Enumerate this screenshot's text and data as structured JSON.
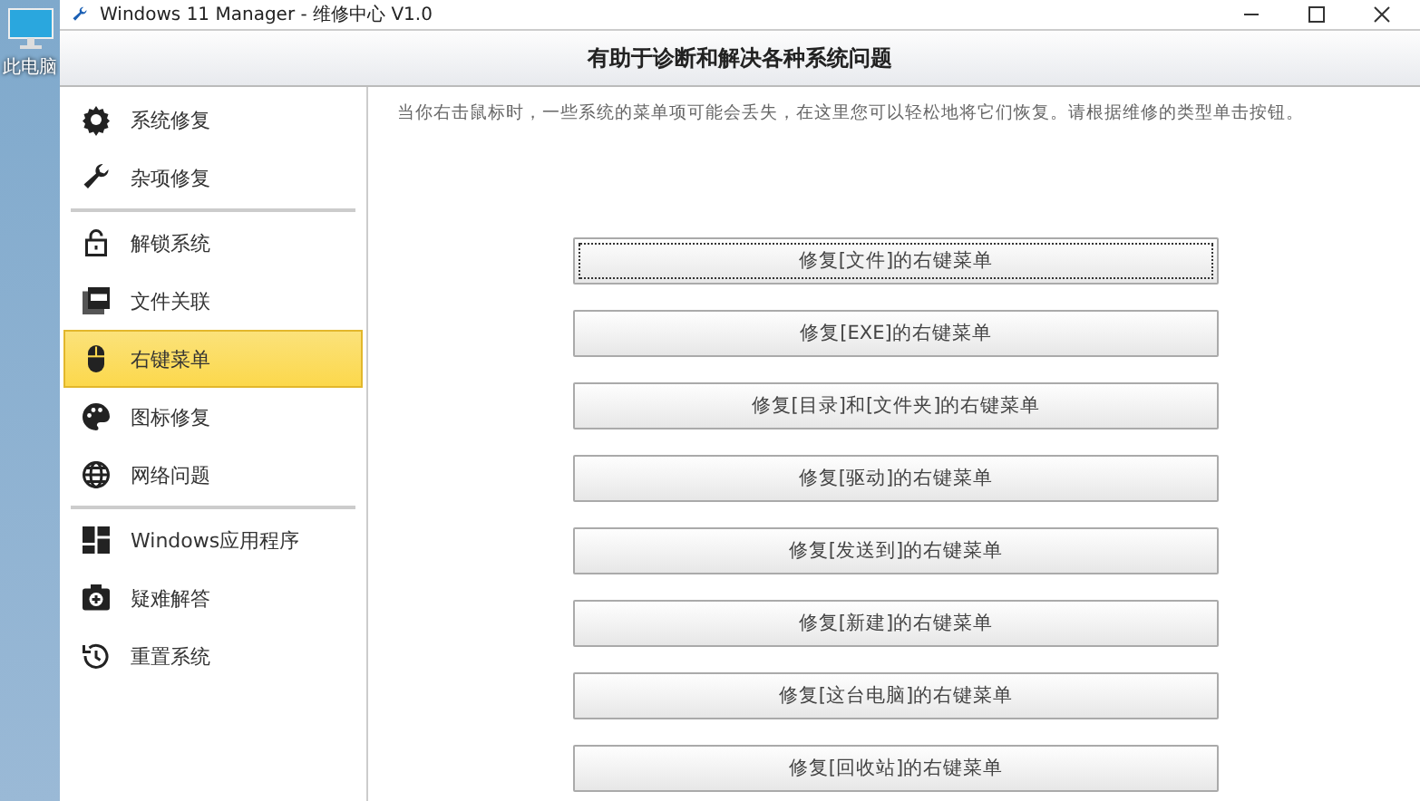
{
  "desktop": {
    "icon_label": "此电脑"
  },
  "window": {
    "title": "Windows 11 Manager - 维修中心 V1.0"
  },
  "header": {
    "title": "有助于诊断和解决各种系统问题"
  },
  "sidebar": {
    "groups": [
      [
        {
          "label": "系统修复",
          "selected": false
        },
        {
          "label": "杂项修复",
          "selected": false
        }
      ],
      [
        {
          "label": "解锁系统",
          "selected": false
        },
        {
          "label": "文件关联",
          "selected": false
        },
        {
          "label": "右键菜单",
          "selected": true
        },
        {
          "label": "图标修复",
          "selected": false
        },
        {
          "label": "网络问题",
          "selected": false
        }
      ],
      [
        {
          "label": "Windows应用程序",
          "selected": false
        },
        {
          "label": "疑难解答",
          "selected": false
        },
        {
          "label": "重置系统",
          "selected": false
        }
      ]
    ]
  },
  "content": {
    "description": "当你右击鼠标时，一些系统的菜单项可能会丢失，在这里您可以轻松地将它们恢复。请根据维修的类型单击按钮。",
    "buttons": [
      {
        "label": "修复[文件]的右键菜单",
        "focused": true
      },
      {
        "label": "修复[EXE]的右键菜单",
        "focused": false
      },
      {
        "label": "修复[目录]和[文件夹]的右键菜单",
        "focused": false
      },
      {
        "label": "修复[驱动]的右键菜单",
        "focused": false
      },
      {
        "label": "修复[发送到]的右键菜单",
        "focused": false
      },
      {
        "label": "修复[新建]的右键菜单",
        "focused": false
      },
      {
        "label": "修复[这台电脑]的右键菜单",
        "focused": false
      },
      {
        "label": "修复[回收站]的右键菜单",
        "focused": false
      }
    ]
  }
}
